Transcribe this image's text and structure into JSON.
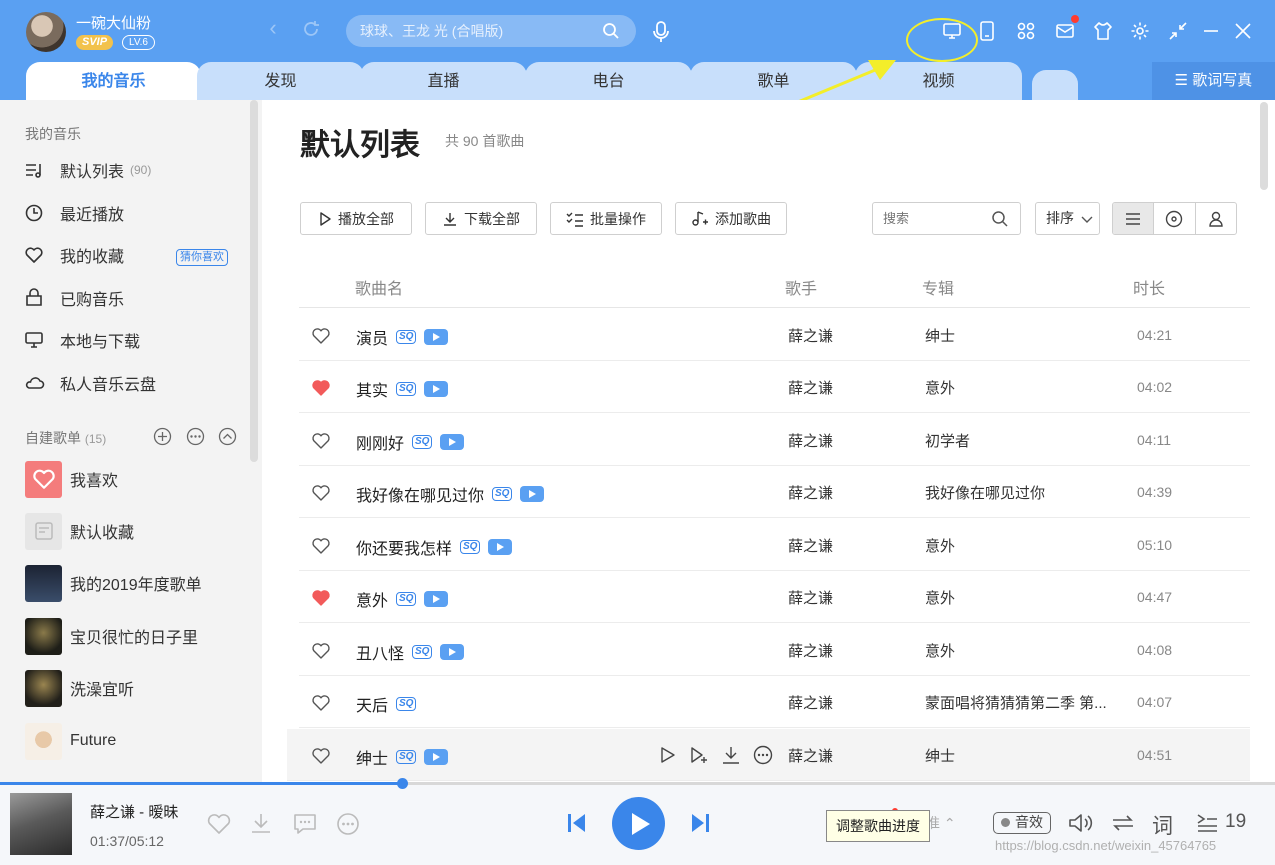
{
  "user": {
    "name": "一碗大仙粉",
    "vip_badge": "SVIP",
    "level": "LV.6"
  },
  "search": {
    "placeholder": "球球、王龙 光 (合唱版)"
  },
  "tabs": [
    {
      "label": "我的音乐",
      "active": true
    },
    {
      "label": "发现"
    },
    {
      "label": "直播"
    },
    {
      "label": "电台"
    },
    {
      "label": "歌单"
    },
    {
      "label": "视频"
    }
  ],
  "lyrics_tab": "歌词写真",
  "sidebar": {
    "section_title": "我的音乐",
    "items": [
      {
        "icon": "list-music-icon",
        "label": "默认列表",
        "count": "(90)"
      },
      {
        "icon": "clock-icon",
        "label": "最近播放"
      },
      {
        "icon": "heart-icon",
        "label": "我的收藏",
        "badge": "猜你喜欢"
      },
      {
        "icon": "shopping-bag-icon",
        "label": "已购音乐"
      },
      {
        "icon": "monitor-icon",
        "label": "本地与下载"
      },
      {
        "icon": "cloud-icon",
        "label": "私人音乐云盘"
      }
    ],
    "playlists_title": "自建歌单",
    "playlists_count": "(15)",
    "playlists": [
      {
        "label": "我喜欢",
        "cover": "#f47c7c"
      },
      {
        "label": "默认收藏",
        "cover": "#e6e6e6"
      },
      {
        "label": "我的2019年度歌单",
        "cover": "#1f2a3c"
      },
      {
        "label": "宝贝很忙的日子里",
        "cover": "#2b2b22"
      },
      {
        "label": "洗澡宜听",
        "cover": "#33301f"
      },
      {
        "label": "Future",
        "cover": "#efe2d2"
      }
    ]
  },
  "main": {
    "title": "默认列表",
    "subtitle": "共 90 首歌曲",
    "actions": [
      "播放全部",
      "下载全部",
      "批量操作",
      "添加歌曲"
    ],
    "search_placeholder": "搜索",
    "sort_label": "排序",
    "columns": {
      "song": "歌曲名",
      "artist": "歌手",
      "album": "专辑",
      "duration": "时长"
    },
    "songs": [
      {
        "title": "演员",
        "sq": "SQ",
        "mv": true,
        "liked": false,
        "artist": "薛之谦",
        "album": "绅士",
        "duration": "04:21"
      },
      {
        "title": "其实",
        "sq": "SQ",
        "mv": true,
        "liked": true,
        "artist": "薛之谦",
        "album": "意外",
        "duration": "04:02"
      },
      {
        "title": "刚刚好",
        "sq": "SQ",
        "mv": true,
        "liked": false,
        "artist": "薛之谦",
        "album": "初学者",
        "duration": "04:11"
      },
      {
        "title": "我好像在哪见过你",
        "sq": "SQ",
        "mv": true,
        "liked": false,
        "artist": "薛之谦",
        "album": "我好像在哪见过你",
        "duration": "04:39"
      },
      {
        "title": "你还要我怎样",
        "sq": "SQ",
        "mv": true,
        "liked": false,
        "artist": "薛之谦",
        "album": "意外",
        "duration": "05:10"
      },
      {
        "title": "意外",
        "sq": "SQ",
        "mv": true,
        "liked": true,
        "artist": "薛之谦",
        "album": "意外",
        "duration": "04:47"
      },
      {
        "title": "丑八怪",
        "sq": "SQ",
        "mv": true,
        "liked": false,
        "artist": "薛之谦",
        "album": "意外",
        "duration": "04:08"
      },
      {
        "title": "天后",
        "sq": "SQ",
        "mv": false,
        "liked": false,
        "artist": "薛之谦",
        "album": "蒙面唱将猜猜猜第二季 第...",
        "duration": "04:07"
      },
      {
        "title": "绅士",
        "sq": "SQ",
        "mv": true,
        "liked": false,
        "artist": "薛之谦",
        "album": "绅士",
        "duration": "04:51",
        "hover": true
      }
    ]
  },
  "player": {
    "now_playing": "薛之谦 - 暧昧",
    "time": "01:37/05:12",
    "progress": 0.315,
    "tooltip": "调整歌曲进度",
    "effect_label": "音效",
    "lyric_label": "词",
    "queue_count": "19"
  },
  "watermark": "https://blog.csdn.net/weixin_45764765",
  "colors": {
    "accent": "#3a86ea",
    "topbar": "#5aa0f2",
    "liked": "#f25a5a",
    "annotation": "#f3ee2a"
  }
}
